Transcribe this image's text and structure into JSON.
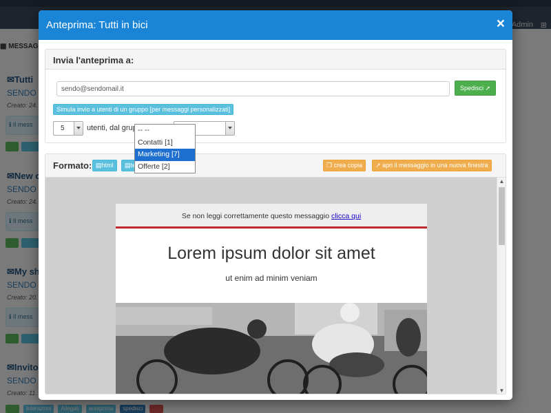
{
  "background": {
    "user": "Admin",
    "sidebar_title": "MESSAGG",
    "items": [
      {
        "title": "Tutti",
        "sender": "SENDO",
        "created": "Creato: 24.",
        "info": "Il mess"
      },
      {
        "title": "New c",
        "sender": "SENDO",
        "created": "Creato: 24.",
        "info": "Il mess"
      },
      {
        "title": "My sh",
        "sender": "SENDO",
        "created": "Creato: 20.",
        "info": "Il mess"
      },
      {
        "title": "Invito",
        "sender": "SENDO",
        "created": "Creato: 11."
      }
    ],
    "bottom_buttons": [
      "interazioni",
      "Allegati",
      "anteprima",
      "spedisci"
    ]
  },
  "modal": {
    "title": "Anteprima: Tutti in bici",
    "close": "×",
    "send_section": {
      "heading": "Invia l'anteprima a:",
      "email_value": "sendo@sendomail.it",
      "send_button": "Spedisci",
      "simulate_button": "Simula invio a utenti di un gruppo [per messaggi personalizzati]",
      "count_value": "5",
      "users_label": "utenti, dal gruppo di invio:",
      "group_value": "-- --",
      "group_options": [
        {
          "label": "-- --",
          "selected": false
        },
        {
          "label": "Contatti [1]",
          "selected": false
        },
        {
          "label": "Marketing [7]",
          "selected": true
        },
        {
          "label": "Offerte [2]",
          "selected": false
        }
      ]
    },
    "format_section": {
      "label": "Formato:",
      "html_button": "html",
      "text_button": "testo",
      "copy_button": "crea copia",
      "open_button": "apri il messaggio in una nuova finestra"
    },
    "preview": {
      "topbar_text": "Se non leggi correttamente questo messaggio",
      "topbar_link": "clicca qui",
      "headline": "Lorem ipsum dolor sit amet",
      "subheadline": "ut enim ad minim veniam"
    }
  },
  "colors": {
    "header": "#1a84d6",
    "success": "#4cae4c",
    "info": "#5bc0de",
    "warning": "#f0ad4e",
    "accent_line": "#c0282d"
  }
}
